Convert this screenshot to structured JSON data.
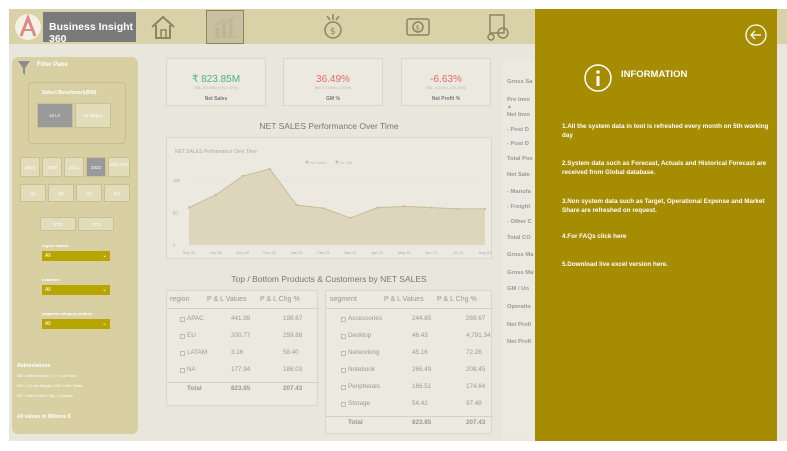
{
  "header": {
    "app_title": "Business Insight 360",
    "nav_icons": [
      "home-icon",
      "bar-chart-icon",
      "money-gear-icon",
      "dollar-flow-icon",
      "supply-chain-icon"
    ]
  },
  "filter_pane": {
    "title": "Filter Pane",
    "benchmark_label": "Select Benchmark(BM)",
    "benchmark_options": [
      "vs LY",
      "vs Target"
    ],
    "years": [
      "2019",
      "2020",
      "2021",
      "2022",
      "2022 EST"
    ],
    "quarters": [
      "Q1",
      "Q2",
      "Q3",
      "Q4"
    ],
    "period_buttons": [
      "YTD",
      "YTG"
    ],
    "region_label": "region market",
    "region_value": "All",
    "customer_label": "customer",
    "customer_value": "All",
    "segment_label": "segment category product",
    "segment_value": "All",
    "abbreviations_title": "Abbreviations",
    "abbreviations": [
      "BM = Benchmark | LY = Last Year",
      "GM = Gross Margin | NS = Net Sales",
      "NP = Net Profit | Chg = Change"
    ],
    "footer": "All values in Millions $"
  },
  "kpis": [
    {
      "value": "₹ 823.85M",
      "sub": "BM: 267.66M (+207.43%)",
      "label": "Net Sales",
      "color": "#4fb37f"
    },
    {
      "value": "36.49%",
      "sub": "BM: 37.15% (-1.65%)",
      "label": "GM %",
      "color": "#e46a6a"
    },
    {
      "value": "-6.63%",
      "sub": "BM: -4.81% (-475.16%)",
      "label": "Net Profit %",
      "color": "#e46a6a"
    }
  ],
  "chart_section_title": "NET SALES Performance Over Time",
  "chart_data": {
    "type": "area",
    "title": "NET SALES Performance Over Time",
    "legend": [
      "Net sales",
      "vs. BM"
    ],
    "x": [
      "Sep 20",
      "Oct 20",
      "Nov 20",
      "Dec 20",
      "Jan 21",
      "Feb 21",
      "Mar 21",
      "Apr 21",
      "May 21",
      "Jun 21",
      "Jul 21",
      "Aug 21"
    ],
    "series": [
      {
        "name": "Net sales",
        "values": [
          58,
          78,
          107,
          118,
          62,
          57,
          42,
          58,
          60,
          58,
          56,
          56
        ]
      }
    ],
    "y_ticks": [
      0,
      50,
      100
    ],
    "ylim": [
      0,
      135
    ]
  },
  "tables_title": "Top / Bottom Products & Customers by NET SALES",
  "region_table": {
    "headers": [
      "region",
      "P & L Values",
      "P & L Chg %"
    ],
    "rows": [
      [
        "APAC",
        "441.98",
        "198.67"
      ],
      [
        "EU",
        "200.77",
        "259.88"
      ],
      [
        "LATAM",
        "3.16",
        "58.40"
      ],
      [
        "NA",
        "177.94",
        "186.03"
      ]
    ],
    "total": [
      "Total",
      "823.85",
      "207.43"
    ]
  },
  "segment_table": {
    "headers": [
      "segment",
      "P & L Values",
      "P & L Chg %"
    ],
    "rows": [
      [
        "Accessories",
        "244.85",
        "269.67"
      ],
      [
        "Desktop",
        "46.43",
        "4,791.34"
      ],
      [
        "Networking",
        "45.16",
        "72.26"
      ],
      [
        "Notebook",
        "266.49",
        "208.45"
      ],
      [
        "Peripherals",
        "166.51",
        "174.64"
      ],
      [
        "Storage",
        "54.42",
        "97.48"
      ]
    ],
    "total": [
      "Total",
      "823.85",
      "207.43"
    ]
  },
  "right_panel_items": [
    "Gross Sa",
    "Pre Invo",
    "Net Invo",
    "- Post D",
    "- Post D",
    "Total Pos",
    "Net Sale",
    "- Manufa",
    "- Freight",
    "- Other C",
    "Total CO",
    "Gross Ma",
    "Gross Ma",
    "GM / Un",
    "Operatio",
    "Net Profi",
    "Net Profi"
  ],
  "info_panel": {
    "title": "INFORMATION",
    "items": [
      "1.All the system data in tool is refreshed every month on 5th working day",
      "2.System data such as Forecast, Actuals and Historical Forecast are received from Global database.",
      "3.Non system data such as Target, Operational Expense and Market Share are refreshed on request.",
      "4.For FAQs click here",
      "5.Download live excel version here."
    ],
    "bg_color": "#a68c00"
  }
}
